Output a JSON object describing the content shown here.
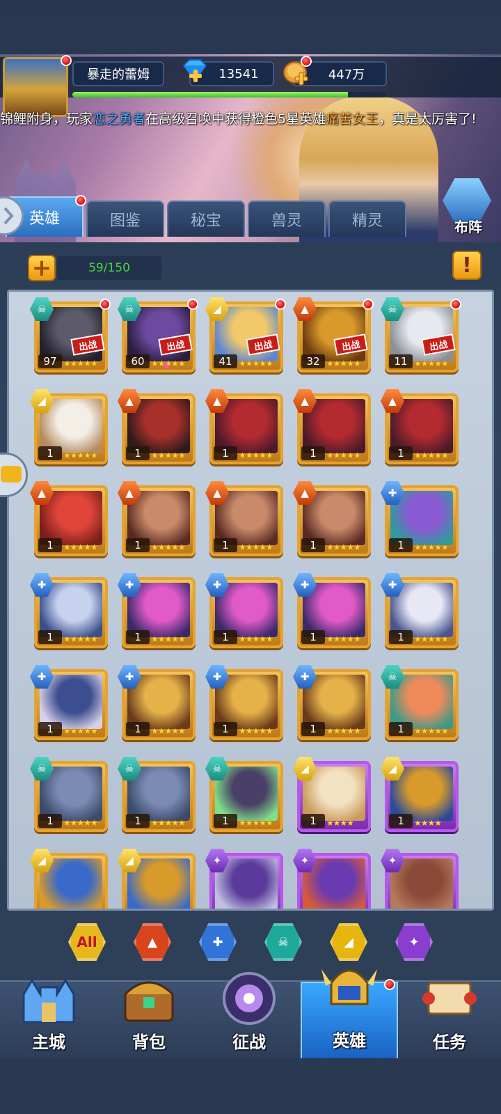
{
  "header": {
    "player_name": "暴走的蕾姆",
    "diamonds": "13541",
    "gold": "447万",
    "exp_progress": 0.88
  },
  "ticker": {
    "part1": "锦鲤附身，玩家",
    "player": "恋之勇者",
    "part2": "在高级召唤中获得橙色5星英雄",
    "hero": "痛苦女王",
    "part3": "，真是太厉害了!"
  },
  "tabs": [
    "英雄",
    "图鉴",
    "秘宝",
    "兽灵",
    "精灵"
  ],
  "lineup_label": "布阵",
  "hero_count": "59/150",
  "deploy_label": "出战",
  "heroes": [
    {
      "faction": "undead",
      "level": "97",
      "stars": 5,
      "deployed": true,
      "dot": true,
      "frame": "gold",
      "colors": [
        "#5d5a6b",
        "#22202e"
      ]
    },
    {
      "faction": "undead",
      "level": "60",
      "stars": 5,
      "deployed": true,
      "dot": true,
      "frame": "gold",
      "pink_star": true,
      "colors": [
        "#6d4aa0",
        "#2a1d40"
      ]
    },
    {
      "faction": "light",
      "level": "41",
      "stars": 5,
      "deployed": true,
      "dot": true,
      "frame": "gold",
      "colors": [
        "#f1c96a",
        "#5c87d4"
      ]
    },
    {
      "faction": "fire",
      "level": "32",
      "stars": 5,
      "deployed": true,
      "dot": true,
      "frame": "gold",
      "colors": [
        "#d99a2b",
        "#6a3a10"
      ]
    },
    {
      "faction": "undead",
      "level": "11",
      "stars": 5,
      "deployed": true,
      "dot": true,
      "frame": "gold",
      "colors": [
        "#e6e9ee",
        "#8a8f99"
      ]
    },
    {
      "faction": "light",
      "level": "1",
      "stars": 5,
      "frame": "gold",
      "colors": [
        "#f3efe6",
        "#b58b60"
      ]
    },
    {
      "faction": "fire",
      "level": "1",
      "stars": 5,
      "frame": "gold",
      "colors": [
        "#a7302a",
        "#2c1a1c"
      ]
    },
    {
      "faction": "fire",
      "level": "1",
      "stars": 5,
      "frame": "gold",
      "colors": [
        "#b32a30",
        "#4a1a2a"
      ]
    },
    {
      "faction": "fire",
      "level": "1",
      "stars": 5,
      "frame": "gold",
      "colors": [
        "#b32a30",
        "#4a1a2a"
      ]
    },
    {
      "faction": "fire",
      "level": "1",
      "stars": 5,
      "frame": "gold",
      "colors": [
        "#b32a30",
        "#4a1a2a"
      ]
    },
    {
      "faction": "fire",
      "level": "1",
      "stars": 5,
      "frame": "gold",
      "colors": [
        "#e0453a",
        "#7a1f1a"
      ]
    },
    {
      "faction": "fire",
      "level": "1",
      "stars": 5,
      "frame": "gold",
      "colors": [
        "#c98a6a",
        "#5a2a22"
      ]
    },
    {
      "faction": "fire",
      "level": "1",
      "stars": 5,
      "frame": "gold",
      "colors": [
        "#c98a6a",
        "#5a2a22"
      ]
    },
    {
      "faction": "fire",
      "level": "1",
      "stars": 5,
      "frame": "gold",
      "colors": [
        "#c98a6a",
        "#5a2a22"
      ]
    },
    {
      "faction": "nature",
      "level": "1",
      "stars": 5,
      "frame": "gold",
      "colors": [
        "#8a5ad2",
        "#2e9c9a"
      ]
    },
    {
      "faction": "nature",
      "level": "1",
      "stars": 5,
      "frame": "gold",
      "colors": [
        "#c7d2ef",
        "#3a4f8c"
      ]
    },
    {
      "faction": "nature",
      "level": "1",
      "stars": 5,
      "frame": "gold",
      "colors": [
        "#e05ac8",
        "#3a2a6a"
      ]
    },
    {
      "faction": "nature",
      "level": "1",
      "stars": 5,
      "frame": "gold",
      "colors": [
        "#e05ac8",
        "#3a2a6a"
      ]
    },
    {
      "faction": "nature",
      "level": "1",
      "stars": 5,
      "frame": "gold",
      "colors": [
        "#e05ac8",
        "#3a2a6a"
      ]
    },
    {
      "faction": "nature",
      "level": "1",
      "stars": 5,
      "frame": "gold",
      "colors": [
        "#e8e8f5",
        "#4a5590"
      ]
    },
    {
      "faction": "nature",
      "level": "1",
      "stars": 5,
      "frame": "gold",
      "colors": [
        "#3c4e8f",
        "#d8d0e8"
      ]
    },
    {
      "faction": "nature",
      "level": "1",
      "stars": 5,
      "frame": "gold",
      "colors": [
        "#e5b24a",
        "#6a3a1a"
      ]
    },
    {
      "faction": "nature",
      "level": "1",
      "stars": 5,
      "frame": "gold",
      "colors": [
        "#e5b24a",
        "#6a3a1a"
      ]
    },
    {
      "faction": "nature",
      "level": "1",
      "stars": 5,
      "frame": "gold",
      "colors": [
        "#e5b24a",
        "#6a3a1a"
      ]
    },
    {
      "faction": "undead",
      "level": "1",
      "stars": 5,
      "frame": "gold",
      "colors": [
        "#f08a5a",
        "#3a9a8a"
      ]
    },
    {
      "faction": "undead",
      "level": "1",
      "stars": 5,
      "frame": "gold",
      "colors": [
        "#7c8bb3",
        "#3a4a6a"
      ]
    },
    {
      "faction": "undead",
      "level": "1",
      "stars": 5,
      "frame": "gold",
      "colors": [
        "#7c8bb3",
        "#3a4a6a"
      ]
    },
    {
      "faction": "undead",
      "level": "1",
      "stars": 5,
      "frame": "gold",
      "colors": [
        "#4a3f66",
        "#7fe08a"
      ]
    },
    {
      "faction": "light",
      "level": "1",
      "stars": 4,
      "frame": "purple",
      "colors": [
        "#f3e2c2",
        "#c99a5a"
      ]
    },
    {
      "faction": "light",
      "level": "1",
      "stars": 4,
      "frame": "purple",
      "colors": [
        "#d89a2a",
        "#2a4a9a"
      ]
    }
  ],
  "partial_row": [
    {
      "faction": "light",
      "colors": [
        "#3a6ac9",
        "#d89a2a"
      ]
    },
    {
      "faction": "light",
      "colors": [
        "#d89a2a",
        "#3a6ac9"
      ]
    },
    {
      "faction": "dark",
      "colors": [
        "#5a3a9a",
        "#c0c0e0"
      ]
    },
    {
      "faction": "dark",
      "colors": [
        "#6a3ab0",
        "#d85a3a"
      ]
    },
    {
      "faction": "dark",
      "colors": [
        "#8a4a3a",
        "#b57a5a"
      ]
    }
  ],
  "filters": [
    {
      "name": "all",
      "label": "All",
      "color": "#e6b81e"
    },
    {
      "name": "fire",
      "color": "#d8441c"
    },
    {
      "name": "nature",
      "color": "#2f74d6"
    },
    {
      "name": "undead",
      "color": "#1fa99a"
    },
    {
      "name": "light",
      "color": "#e7b510"
    },
    {
      "name": "dark",
      "color": "#8a3ed0"
    }
  ],
  "bottom_nav": [
    "主城",
    "背包",
    "征战",
    "英雄",
    "任务"
  ],
  "active_nav": 3
}
